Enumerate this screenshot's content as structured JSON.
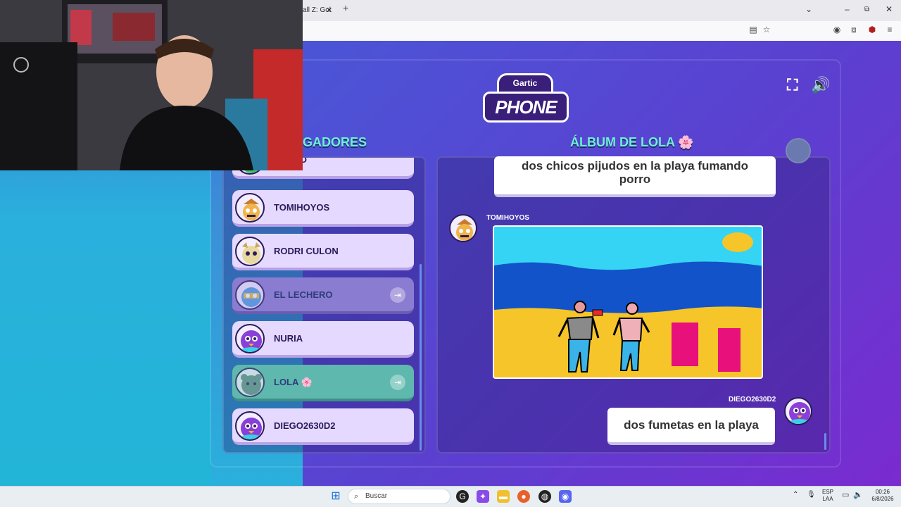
{
  "browser": {
    "tab_title": "all Z: Gol",
    "tab_close": "✕",
    "new_tab": "+"
  },
  "game": {
    "logo_top": "Gartic",
    "logo_bottom": "PHONE",
    "players_heading": "GADORES",
    "album_heading": "ÁLBUM DE LOLA 🌸",
    "players": [
      {
        "name": "REANO"
      },
      {
        "name": "TOMIHOYOS"
      },
      {
        "name": "RODRI CULON"
      },
      {
        "name": "EL LECHERO"
      },
      {
        "name": "NURIA"
      },
      {
        "name": "LOLA 🌸"
      },
      {
        "name": "DIEGO2630D2"
      }
    ],
    "album": {
      "first_text": "dos chicos pijudos en la playa fumando porro",
      "drawing_author": "TOMIHOYOS",
      "guess_author": "DIEGO2630D2",
      "guess_text": "dos fumetas en la playa"
    }
  },
  "taskbar": {
    "search_placeholder": "Buscar",
    "lang_top": "ESP",
    "lang_bottom": "LAA",
    "time": "00:26",
    "date": "6/8/2026"
  },
  "colors": {
    "heading_teal": "#6ff0d6",
    "sky": "#35d4f5",
    "sea": "#1353c9",
    "sand": "#f5c52a",
    "pink_box": "#e8107a"
  }
}
